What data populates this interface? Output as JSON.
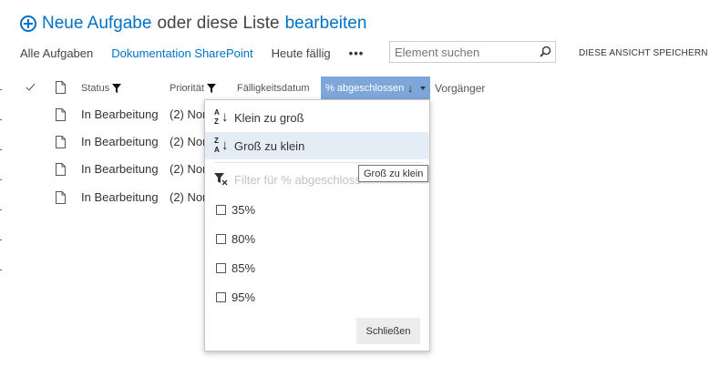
{
  "header": {
    "new_task": "Neue Aufgabe",
    "or_text": "oder diese Liste",
    "edit": "bearbeiten"
  },
  "views": {
    "items": [
      {
        "label": "Alle Aufgaben",
        "selected": false
      },
      {
        "label": "Dokumentation SharePoint",
        "selected": true
      },
      {
        "label": "Heute fällig",
        "selected": false
      }
    ],
    "more": "•••"
  },
  "search": {
    "placeholder": "Element suchen",
    "icon": "search-icon"
  },
  "save_view": "DIESE ANSICHT SPEICHERN",
  "columns": {
    "status": "Status",
    "priority": "Priorität",
    "due_date": "Fälligkeitsdatum",
    "percent_complete": "% abgeschlossen",
    "predecessor": "Vorgänger"
  },
  "rows": [
    {
      "status": "In Bearbeitung",
      "priority": "(2) Normal"
    },
    {
      "status": "In Bearbeitung",
      "priority": "(2) Normal"
    },
    {
      "status": "In Bearbeitung",
      "priority": "(2) Normal"
    },
    {
      "status": "In Bearbeitung",
      "priority": "(2) Normal"
    }
  ],
  "menu": {
    "sort_asc": "Klein zu groß",
    "sort_desc": "Groß zu klein",
    "filter_label": "Filter für % abgeschlossen",
    "options": [
      "35%",
      "80%",
      "85%",
      "95%"
    ],
    "close": "Schließen"
  },
  "tooltip": "Groß zu klein",
  "colors": {
    "accent": "#0072c6",
    "column_active": "#7ea6d8",
    "menu_highlight": "#e4ecf6"
  }
}
